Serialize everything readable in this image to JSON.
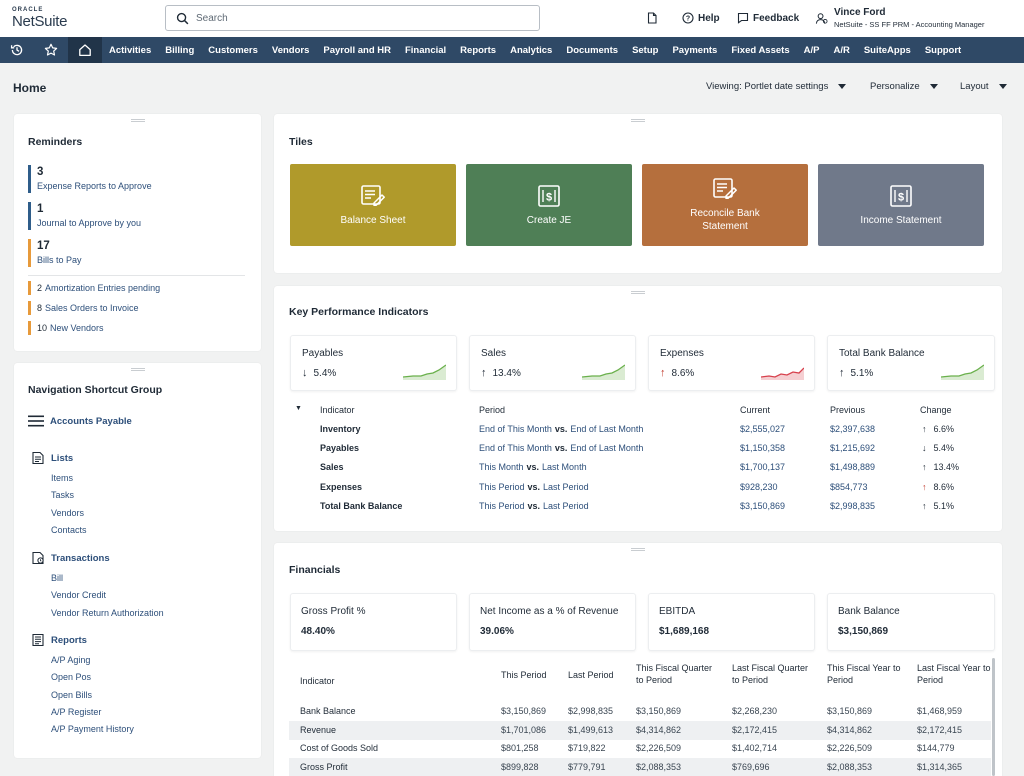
{
  "header": {
    "logo_top": "ORACLE",
    "logo_main": "NetSuite",
    "search_placeholder": "Search",
    "help": "Help",
    "feedback": "Feedback",
    "user_name": "Vince Ford",
    "user_role": "NetSuite - SS FF PRM - Accounting Manager"
  },
  "nav": [
    "Activities",
    "Billing",
    "Customers",
    "Vendors",
    "Payroll and HR",
    "Financial",
    "Reports",
    "Analytics",
    "Documents",
    "Setup",
    "Payments",
    "Fixed Assets",
    "A/P",
    "A/R",
    "SuiteApps",
    "Support"
  ],
  "page": {
    "title": "Home",
    "viewing": "Viewing: Portlet date settings",
    "personalize": "Personalize",
    "layout": "Layout"
  },
  "reminders": {
    "title": "Reminders",
    "big": [
      {
        "count": "3",
        "label": "Expense Reports to Approve",
        "color": "#2f5d8a"
      },
      {
        "count": "1",
        "label": "Journal to Approve by you",
        "color": "#2f5d8a"
      },
      {
        "count": "17",
        "label": "Bills to Pay",
        "color": "#e79a3b"
      }
    ],
    "small": [
      {
        "count": "2",
        "label": "Amortization Entries pending"
      },
      {
        "count": "8",
        "label": "Sales Orders to Invoice"
      },
      {
        "count": "10",
        "label": "New Vendors"
      }
    ]
  },
  "nav_shortcuts": {
    "title": "Navigation Shortcut Group",
    "accounts_payable": "Accounts Payable",
    "groups": [
      {
        "label": "Lists",
        "icon": "list-icon",
        "links": [
          "Items",
          "Tasks",
          "Vendors",
          "Contacts"
        ]
      },
      {
        "label": "Transactions",
        "icon": "transactions-icon",
        "links": [
          "Bill",
          "Vendor Credit",
          "Vendor Return Authorization"
        ]
      },
      {
        "label": "Reports",
        "icon": "report-icon",
        "links": [
          "A/P Aging",
          "Open Pos",
          "Open Bills",
          "A/P Register",
          "A/P Payment History"
        ]
      }
    ]
  },
  "tiles": {
    "title": "Tiles",
    "items": [
      {
        "label": "Balance Sheet",
        "color": "#b09a2b",
        "icon": "ledger-edit-icon"
      },
      {
        "label": "Create JE",
        "color": "#4f7f56",
        "icon": "dollar-doc-icon"
      },
      {
        "label": "Reconcile Bank Statement",
        "color": "#b56f3d",
        "icon": "ledger-edit-icon"
      },
      {
        "label": "Income Statement",
        "color": "#70798a",
        "icon": "dollar-doc-icon"
      }
    ]
  },
  "kpi": {
    "title": "Key Performance Indicators",
    "cards": [
      {
        "label": "Payables",
        "direction": "down",
        "value": "5.4%",
        "trend": "up",
        "color": "#6ab04c"
      },
      {
        "label": "Sales",
        "direction": "up",
        "value": "13.4%",
        "trend": "up",
        "color": "#6ab04c"
      },
      {
        "label": "Expenses",
        "direction": "up",
        "value": "8.6%",
        "trend": "up",
        "color": "#d7414d",
        "arrow_color": "#c0392b"
      },
      {
        "label": "Total Bank Balance",
        "direction": "up",
        "value": "5.1%",
        "trend": "up",
        "color": "#6ab04c"
      }
    ],
    "table": {
      "headers": [
        "Indicator",
        "Period",
        "Current",
        "Previous",
        "Change"
      ],
      "vs": "vs.",
      "rows": [
        {
          "indicator": "Inventory",
          "p1": "End of This Month",
          "p2": "End of Last Month",
          "current": "$2,555,027",
          "previous": "$2,397,638",
          "dir": "up",
          "change": "6.6%"
        },
        {
          "indicator": "Payables",
          "p1": "End of This Month",
          "p2": "End of Last Month",
          "current": "$1,150,358",
          "previous": "$1,215,692",
          "dir": "down",
          "change": "5.4%"
        },
        {
          "indicator": "Sales",
          "p1": "This Month",
          "p2": "Last Month",
          "current": "$1,700,137",
          "previous": "$1,498,889",
          "dir": "up",
          "change": "13.4%"
        },
        {
          "indicator": "Expenses",
          "p1": "This Period",
          "p2": "Last Period",
          "current": "$928,230",
          "previous": "$854,773",
          "dir": "up-red",
          "change": "8.6%"
        },
        {
          "indicator": "Total Bank Balance",
          "p1": "This Period",
          "p2": "Last Period",
          "current": "$3,150,869",
          "previous": "$2,998,835",
          "dir": "up",
          "change": "5.1%"
        }
      ]
    }
  },
  "financials": {
    "title": "Financials",
    "cards": [
      {
        "label": "Gross Profit %",
        "value": "48.40%"
      },
      {
        "label": "Net Income as a % of Revenue",
        "value": "39.06%"
      },
      {
        "label": "EBITDA",
        "value": "$1,689,168"
      },
      {
        "label": "Bank Balance",
        "value": "$3,150,869"
      }
    ],
    "headers": [
      "Indicator",
      "This Period",
      "Last Period",
      "This Fiscal Quarter to Period",
      "Last Fiscal Quarter to Period",
      "This Fiscal Year to Period",
      "Last Fiscal Year to Period"
    ],
    "rows": [
      [
        "Bank Balance",
        "$3,150,869",
        "$2,998,835",
        "$3,150,869",
        "$2,268,230",
        "$3,150,869",
        "$1,468,959"
      ],
      [
        "Revenue",
        "$1,701,086",
        "$1,499,613",
        "$4,314,862",
        "$2,172,415",
        "$4,314,862",
        "$2,172,415"
      ],
      [
        "Cost of Goods Sold",
        "$801,258",
        "$719,822",
        "$2,226,509",
        "$1,402,714",
        "$2,226,509",
        "$144,779"
      ],
      [
        "Gross Profit",
        "$899,828",
        "$779,791",
        "$2,088,353",
        "$769,696",
        "$2,088,353",
        "$1,314,365"
      ]
    ]
  }
}
